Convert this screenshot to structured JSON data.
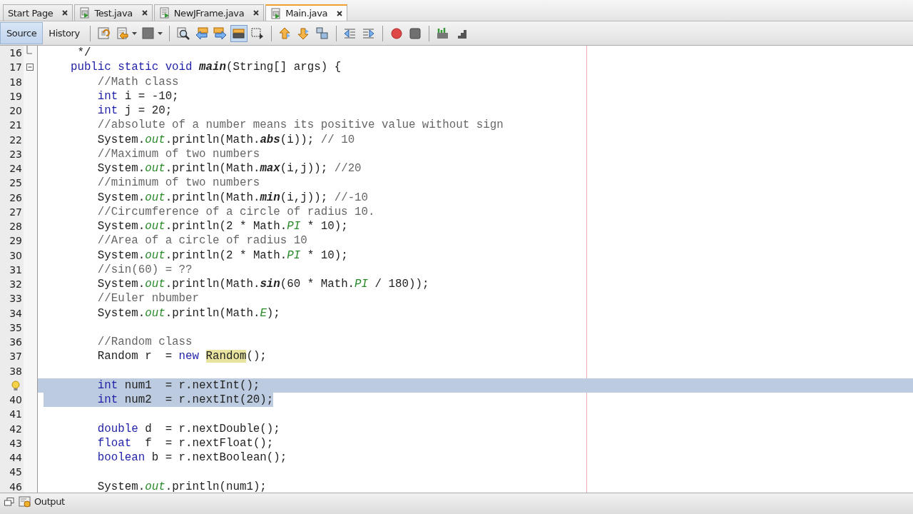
{
  "tabs": [
    {
      "label": "Start Page",
      "kind": "page",
      "selected": false
    },
    {
      "label": "Test.java",
      "kind": "file",
      "selected": false
    },
    {
      "label": "NewJFrame.java",
      "kind": "form",
      "selected": false
    },
    {
      "label": "Main.java",
      "kind": "file",
      "selected": true
    }
  ],
  "toolbar": {
    "views": [
      {
        "label": "Source",
        "selected": true
      },
      {
        "label": "History",
        "selected": false
      }
    ],
    "groups": [
      [
        {
          "kind": "refresh",
          "selected": false
        },
        {
          "kind": "doc-back",
          "selected": false,
          "caret": true
        },
        {
          "kind": "block",
          "selected": false,
          "caret": true
        }
      ],
      [
        {
          "kind": "find",
          "selected": false
        },
        {
          "kind": "prev",
          "selected": false
        },
        {
          "kind": "next",
          "selected": false
        },
        {
          "kind": "highlight",
          "selected": true
        },
        {
          "kind": "select-rect",
          "selected": false
        }
      ],
      [
        {
          "kind": "up",
          "selected": false
        },
        {
          "kind": "down",
          "selected": false
        },
        {
          "kind": "shapes",
          "selected": false
        }
      ],
      [
        {
          "kind": "shift-left",
          "selected": false
        },
        {
          "kind": "shift-right",
          "selected": false
        }
      ],
      [
        {
          "kind": "record",
          "selected": false
        },
        {
          "kind": "stop",
          "selected": false
        }
      ],
      [
        {
          "kind": "bars",
          "selected": false
        },
        {
          "kind": "steps",
          "selected": false
        }
      ]
    ]
  },
  "editor": {
    "lines": [
      {
        "number": "16",
        "fold_end": true,
        "selected": false,
        "tokens": [
          {
            "kind": "plain",
            "text": "     */"
          }
        ]
      },
      {
        "number": "17",
        "collapsible": true,
        "selected": false,
        "tokens": [
          {
            "kind": "keyword",
            "text": "    public static void "
          },
          {
            "kind": "method",
            "text": "main"
          },
          {
            "kind": "plain",
            "text": "(String[] args) {"
          }
        ]
      },
      {
        "number": "18",
        "selected": false,
        "tokens": [
          {
            "kind": "comment",
            "text": "        //Math class"
          }
        ]
      },
      {
        "number": "19",
        "selected": false,
        "tokens": [
          {
            "kind": "keyword",
            "text": "        int"
          },
          {
            "kind": "plain",
            "text": " i = -10;"
          }
        ]
      },
      {
        "number": "20",
        "selected": false,
        "tokens": [
          {
            "kind": "keyword",
            "text": "        int"
          },
          {
            "kind": "plain",
            "text": " j = 20;"
          }
        ]
      },
      {
        "number": "21",
        "selected": false,
        "tokens": [
          {
            "kind": "comment",
            "text": "        //absolute of a number means its positive value without sign"
          }
        ]
      },
      {
        "number": "22",
        "selected": false,
        "tokens": [
          {
            "kind": "plain",
            "text": "        System."
          },
          {
            "kind": "field",
            "text": "out"
          },
          {
            "kind": "plain",
            "text": ".println(Math."
          },
          {
            "kind": "method",
            "text": "abs"
          },
          {
            "kind": "plain",
            "text": "(i)); "
          },
          {
            "kind": "comment",
            "text": "// 10"
          }
        ]
      },
      {
        "number": "23",
        "selected": false,
        "tokens": [
          {
            "kind": "comment",
            "text": "        //Maximum of two numbers"
          }
        ]
      },
      {
        "number": "24",
        "selected": false,
        "tokens": [
          {
            "kind": "plain",
            "text": "        System."
          },
          {
            "kind": "field",
            "text": "out"
          },
          {
            "kind": "plain",
            "text": ".println(Math."
          },
          {
            "kind": "method",
            "text": "max"
          },
          {
            "kind": "plain",
            "text": "(i,j)); "
          },
          {
            "kind": "comment",
            "text": "//20"
          }
        ]
      },
      {
        "number": "25",
        "selected": false,
        "tokens": [
          {
            "kind": "comment",
            "text": "        //minimum of two numbers"
          }
        ]
      },
      {
        "number": "26",
        "selected": false,
        "tokens": [
          {
            "kind": "plain",
            "text": "        System."
          },
          {
            "kind": "field",
            "text": "out"
          },
          {
            "kind": "plain",
            "text": ".println(Math."
          },
          {
            "kind": "method",
            "text": "min"
          },
          {
            "kind": "plain",
            "text": "(i,j)); "
          },
          {
            "kind": "comment",
            "text": "//-10"
          }
        ]
      },
      {
        "number": "27",
        "selected": false,
        "tokens": [
          {
            "kind": "comment",
            "text": "        //Circumference of a circle of radius 10."
          }
        ]
      },
      {
        "number": "28",
        "selected": false,
        "tokens": [
          {
            "kind": "plain",
            "text": "        System."
          },
          {
            "kind": "field",
            "text": "out"
          },
          {
            "kind": "plain",
            "text": ".println(2 * Math."
          },
          {
            "kind": "field",
            "text": "PI"
          },
          {
            "kind": "plain",
            "text": " * 10);"
          }
        ]
      },
      {
        "number": "29",
        "selected": false,
        "tokens": [
          {
            "kind": "comment",
            "text": "        //Area of a circle of radius 10"
          }
        ]
      },
      {
        "number": "30",
        "selected": false,
        "tokens": [
          {
            "kind": "plain",
            "text": "        System."
          },
          {
            "kind": "field",
            "text": "out"
          },
          {
            "kind": "plain",
            "text": ".println(2 * Math."
          },
          {
            "kind": "field",
            "text": "PI"
          },
          {
            "kind": "plain",
            "text": " * 10);"
          }
        ]
      },
      {
        "number": "31",
        "selected": false,
        "tokens": [
          {
            "kind": "comment",
            "text": "        //sin(60) = ??"
          }
        ]
      },
      {
        "number": "32",
        "selected": false,
        "tokens": [
          {
            "kind": "plain",
            "text": "        System."
          },
          {
            "kind": "field",
            "text": "out"
          },
          {
            "kind": "plain",
            "text": ".println(Math."
          },
          {
            "kind": "method",
            "text": "sin"
          },
          {
            "kind": "plain",
            "text": "(60 * Math."
          },
          {
            "kind": "field",
            "text": "PI"
          },
          {
            "kind": "plain",
            "text": " / 180));"
          }
        ]
      },
      {
        "number": "33",
        "selected": false,
        "tokens": [
          {
            "kind": "comment",
            "text": "        //Euler nbumber"
          }
        ]
      },
      {
        "number": "34",
        "selected": false,
        "tokens": [
          {
            "kind": "plain",
            "text": "        System."
          },
          {
            "kind": "field",
            "text": "out"
          },
          {
            "kind": "plain",
            "text": ".println(Math."
          },
          {
            "kind": "field",
            "text": "E"
          },
          {
            "kind": "plain",
            "text": ");"
          }
        ]
      },
      {
        "number": "35",
        "selected": false
      },
      {
        "number": "36",
        "selected": false,
        "tokens": [
          {
            "kind": "comment",
            "text": "        //Random class"
          }
        ]
      },
      {
        "number": "37",
        "selected": false,
        "tokens": [
          {
            "kind": "plain",
            "text": "        Random r  = "
          },
          {
            "kind": "keyword",
            "text": "new "
          },
          {
            "kind": "marked",
            "text": "Random"
          },
          {
            "kind": "plain",
            "text": "();"
          }
        ]
      },
      {
        "number": "38",
        "selected": false
      },
      {
        "hint": true,
        "selected": true,
        "tokens": [
          {
            "kind": "keyword",
            "text": "        int"
          },
          {
            "kind": "plain",
            "text": " num1  = r.nextInt();"
          }
        ]
      },
      {
        "number": "40",
        "selected": true,
        "tokens": [
          {
            "kind": "keyword",
            "text": "        int"
          },
          {
            "kind": "plain",
            "text": " num2  = r.nextInt(20);"
          }
        ]
      },
      {
        "number": "41",
        "selected": false
      },
      {
        "number": "42",
        "selected": false,
        "tokens": [
          {
            "kind": "keyword",
            "text": "        double"
          },
          {
            "kind": "plain",
            "text": " d  = r.nextDouble();"
          }
        ]
      },
      {
        "number": "43",
        "selected": false,
        "tokens": [
          {
            "kind": "keyword",
            "text": "        float"
          },
          {
            "kind": "plain",
            "text": "  f  = r.nextFloat();"
          }
        ]
      },
      {
        "number": "44",
        "selected": false,
        "tokens": [
          {
            "kind": "keyword",
            "text": "        boolean"
          },
          {
            "kind": "plain",
            "text": " b = r.nextBoolean();"
          }
        ]
      },
      {
        "number": "45",
        "selected": false
      },
      {
        "number": "46",
        "selected": false,
        "tokens": [
          {
            "kind": "plain",
            "text": "        System."
          },
          {
            "kind": "field",
            "text": "out"
          },
          {
            "kind": "plain",
            "text": ".println(num1);"
          }
        ]
      }
    ]
  },
  "output": {
    "label": "Output"
  }
}
